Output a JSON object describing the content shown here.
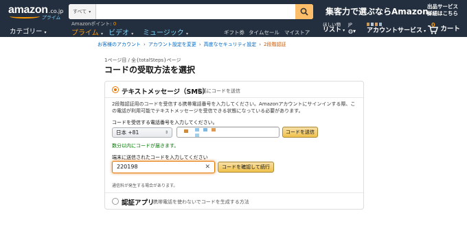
{
  "header": {
    "logo_text": "amazon",
    "logo_suffix": ".co.jp",
    "logo_prime": "プライム",
    "search": {
      "category": "すべて",
      "placeholder": ""
    },
    "promo": "集客力で選ぶならAmazon。",
    "sell_line1": "出品サービス",
    "sell_line2": "詳細はこちら",
    "category_menu": "カテゴリー",
    "points_label": "Amazonポイント:",
    "points_value": "0",
    "prime_link": "プライム",
    "video_link": "ビデオ",
    "music_link": "ミュージック",
    "links": [
      "ギフト券",
      "タイムセール",
      "マイストア"
    ],
    "list_small": "ほしい物",
    "list_big": "リスト",
    "lang": "JP",
    "account_big": "アカウントサービス",
    "cart_count": "0",
    "cart_label": "カート"
  },
  "breadcrumb": {
    "items": [
      "お客様のアカウント",
      "アカウント設定を変更",
      "高度なセキュリティ設定"
    ],
    "current": "2段階認証"
  },
  "page_indicator": "1ページ目 / 全{totalSteps}ページ",
  "title": "コードの受取方法を選択",
  "sms": {
    "title": "テキストメッセージ（SMS）",
    "subtitle": "電話にコードを送信",
    "description": "2段階認証用のコードを受信する携帯電話番号を入力してください。Amazonアカウントにサインインする際、この電話が利用可能でテキストメッセージを受信できる状態になっている必要があります。",
    "phone_label": "コードを受信する電話番号を入力してください。",
    "country_value": "日本 +81",
    "send_button": "コードを送信",
    "sent_message": "数分以内にコードが届きます。",
    "code_label": "端末に送信されたコードを入力してください",
    "code_value": "220198",
    "verify_button": "コードを確認して続行",
    "fee_note": "通信料が発生する場合があります。"
  },
  "auth_app": {
    "title": "認証アプリ",
    "subtitle": "携帯電話を使わないでコードを生成する方法"
  },
  "colors": {
    "nav": "#232f3e",
    "accent": "#ff9900",
    "link": "#0066c0"
  }
}
